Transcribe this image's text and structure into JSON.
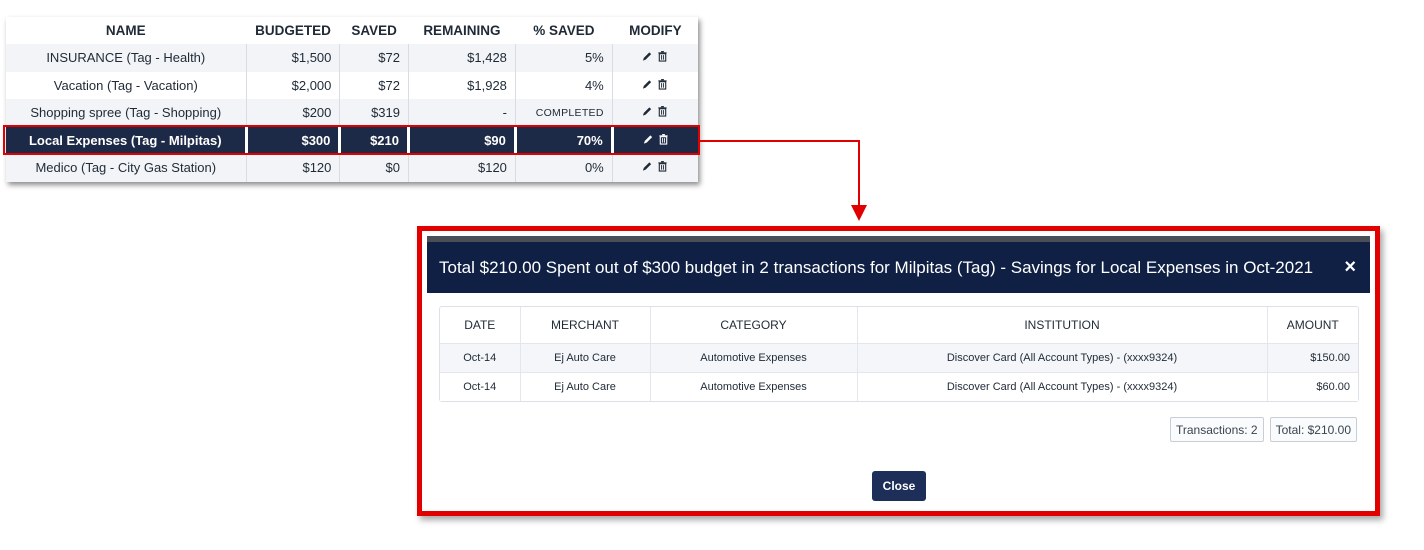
{
  "savings_table": {
    "headers": [
      "NAME",
      "BUDGETED",
      "SAVED",
      "REMAINING",
      "% SAVED",
      "MODIFY"
    ],
    "rows": [
      {
        "name": "INSURANCE (Tag - Health)",
        "budgeted": "$1,500",
        "saved": "$72",
        "remaining": "$1,428",
        "pct": "5%"
      },
      {
        "name": "Vacation (Tag - Vacation)",
        "budgeted": "$2,000",
        "saved": "$72",
        "remaining": "$1,928",
        "pct": "4%"
      },
      {
        "name": "Shopping spree (Tag - Shopping)",
        "budgeted": "$200",
        "saved": "$319",
        "remaining": "-",
        "pct": "COMPLETED"
      },
      {
        "name": "Local Expenses (Tag - Milpitas)",
        "budgeted": "$300",
        "saved": "$210",
        "remaining": "$90",
        "pct": "70%"
      },
      {
        "name": "Medico (Tag - City Gas Station)",
        "budgeted": "$120",
        "saved": "$0",
        "remaining": "$120",
        "pct": "0%"
      }
    ],
    "selected_row_index": 3
  },
  "modal": {
    "title": "Total $210.00 Spent out of $300 budget in 2 transactions for Milpitas (Tag) - Savings for Local Expenses in Oct-2021",
    "close_icon": "×",
    "table": {
      "headers": [
        "DATE",
        "MERCHANT",
        "CATEGORY",
        "INSTITUTION",
        "AMOUNT"
      ],
      "rows": [
        {
          "date": "Oct-14",
          "merchant": "Ej Auto Care",
          "category": "Automotive Expenses",
          "institution": "Discover Card (All Account Types) - (xxxx9324)",
          "amount": "$150.00"
        },
        {
          "date": "Oct-14",
          "merchant": "Ej Auto Care",
          "category": "Automotive Expenses",
          "institution": "Discover Card (All Account Types) - (xxxx9324)",
          "amount": "$60.00"
        }
      ]
    },
    "transactions_count": "Transactions: 2",
    "total": "Total: $210.00",
    "close_button_label": "Close"
  },
  "colors": {
    "highlight_red": "#e10000",
    "navy_header": "#0f2044",
    "selected_row": "#1d2a47"
  },
  "icons": {
    "edit": "pencil-icon",
    "delete": "trash-icon",
    "close": "close-icon"
  }
}
